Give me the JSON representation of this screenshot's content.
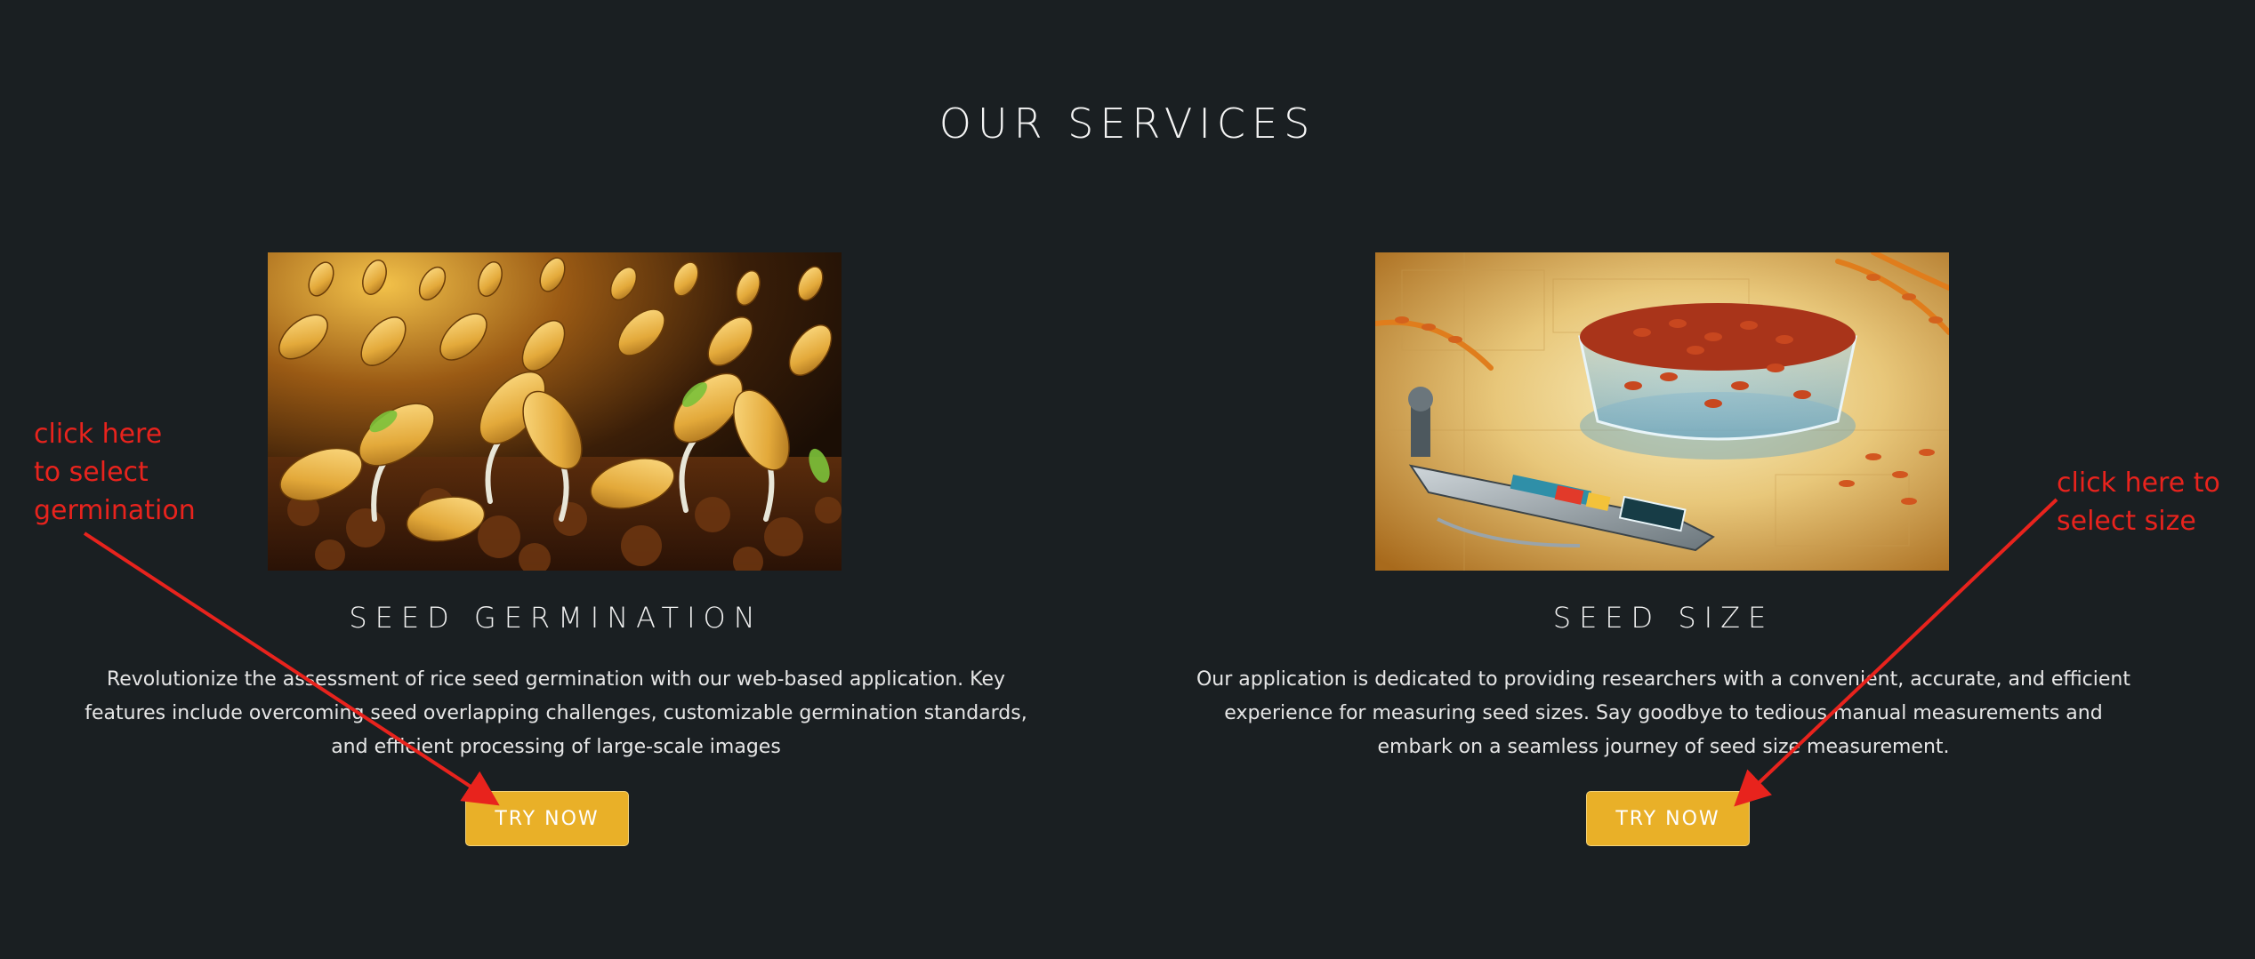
{
  "section": {
    "title": "OUR SERVICES"
  },
  "services": [
    {
      "title": "SEED GERMINATION",
      "description": "Revolutionize the assessment of rice seed germination with our web-based application. Key features include overcoming seed overlapping challenges, customizable germination standards, and efficient processing of large-scale images",
      "button_label": "TRY NOW"
    },
    {
      "title": "SEED SIZE",
      "description": "Our application is dedicated to providing researchers with a convenient, accurate, and efficient experience for measuring seed sizes. Say goodbye to tedious manual measurements and embark on a seamless journey of seed size measurement.",
      "button_label": "TRY NOW"
    }
  ],
  "annotations": {
    "left": "click here\nto select\ngermination",
    "right": "click here to\nselect size"
  },
  "colors": {
    "background": "#1a1f22",
    "button": "#e9b028",
    "annotation": "#e8231d"
  }
}
